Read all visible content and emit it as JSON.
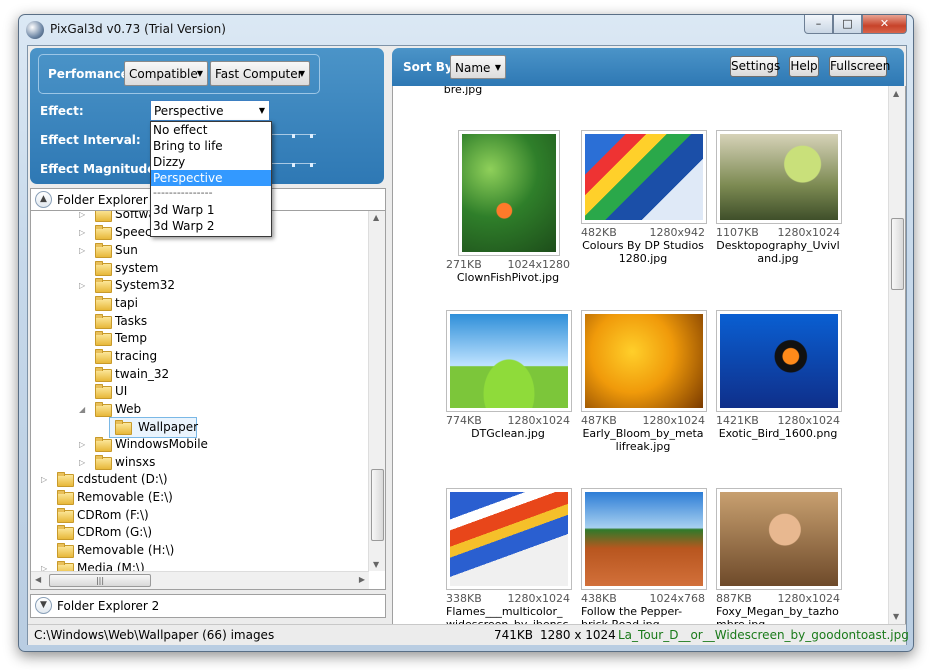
{
  "window": {
    "title": "PixGal3d v0.73 (Trial Version)",
    "min": "–",
    "max": "□",
    "close": "✕"
  },
  "settings": {
    "performance_label": "Perfomance:",
    "performance_value": "Compatible",
    "computer_value": "Fast Computer",
    "effect_label": "Effect:",
    "effect_value": "Perspective",
    "interval_label": "Effect Interval:",
    "magnitude_label": "Effect Magnitude:",
    "effect_options": [
      "No effect",
      "Bring to life",
      "Dizzy",
      "Perspective",
      "---------------",
      "3d Warp 1",
      "3d Warp 2"
    ],
    "selected_option": "Perspective"
  },
  "folder_explorer": {
    "title": "Folder Explorer",
    "title2": "Folder Explorer 2",
    "items": [
      {
        "label": "Softwa",
        "expander": "▷"
      },
      {
        "label": "Speech",
        "expander": "▷"
      },
      {
        "label": "Sun",
        "expander": "▷"
      },
      {
        "label": "system",
        "expander": ""
      },
      {
        "label": "System32",
        "expander": "▷"
      },
      {
        "label": "tapi",
        "expander": ""
      },
      {
        "label": "Tasks",
        "expander": ""
      },
      {
        "label": "Temp",
        "expander": ""
      },
      {
        "label": "tracing",
        "expander": ""
      },
      {
        "label": "twain_32",
        "expander": ""
      },
      {
        "label": "UI",
        "expander": ""
      },
      {
        "label": "Web",
        "expander": "◢"
      },
      {
        "label": "Wallpaper",
        "expander": ""
      },
      {
        "label": "WindowsMobile",
        "expander": "▷"
      },
      {
        "label": "winsxs",
        "expander": "▷"
      },
      {
        "label": "cdstudent (D:\\)",
        "expander": "▷"
      },
      {
        "label": "Removable (E:\\)",
        "expander": ""
      },
      {
        "label": "CDRom (F:\\)",
        "expander": ""
      },
      {
        "label": "CDRom (G:\\)",
        "expander": ""
      },
      {
        "label": "Removable (H:\\)",
        "expander": ""
      },
      {
        "label": "Media (M:\\)",
        "expander": "▷"
      }
    ]
  },
  "toolbar": {
    "sort_label": "Sort By:",
    "sort_value": "Name",
    "settings_btn": "Settings",
    "help_btn": "Help",
    "fullscreen_btn": "Fullscreen"
  },
  "gallery": {
    "partial_top": "bre.jpg",
    "images": [
      {
        "size": "271KB",
        "dims": "1024x1280",
        "name": "ClownFishPivot.jpg"
      },
      {
        "size": "482KB",
        "dims": "1280x942",
        "name": "Colours By DP Studios 1280.jpg"
      },
      {
        "size": "1107KB",
        "dims": "1280x1024",
        "name": "Desktopography_Uvivland.jpg"
      },
      {
        "size": "774KB",
        "dims": "1280x1024",
        "name": "DTGclean.jpg"
      },
      {
        "size": "487KB",
        "dims": "1280x1024",
        "name": "Early_Bloom_by_metalifreak.jpg"
      },
      {
        "size": "1421KB",
        "dims": "1280x1024",
        "name": "Exotic_Bird_1600.png"
      },
      {
        "size": "338KB",
        "dims": "1280x1024",
        "name": "Flames___multicolor_widescreen_by_ibensch.jpg"
      },
      {
        "size": "438KB",
        "dims": "1024x768",
        "name": "Follow the Pepper-brick Road.jpg"
      },
      {
        "size": "887KB",
        "dims": "1280x1024",
        "name": "Foxy_Megan_by_tazhombre.jpg"
      }
    ]
  },
  "status": {
    "path": "C:\\Windows\\Web\\Wallpaper  (66) images",
    "size": "741KB",
    "dims": "1280 x 1024",
    "file": "La_Tour_D__or__Widescreen_by_goodontoast.jpg"
  },
  "colors": {
    "accent": "#2e78b4",
    "selection": "#3399ff",
    "status_file": "#1a7a1a"
  }
}
